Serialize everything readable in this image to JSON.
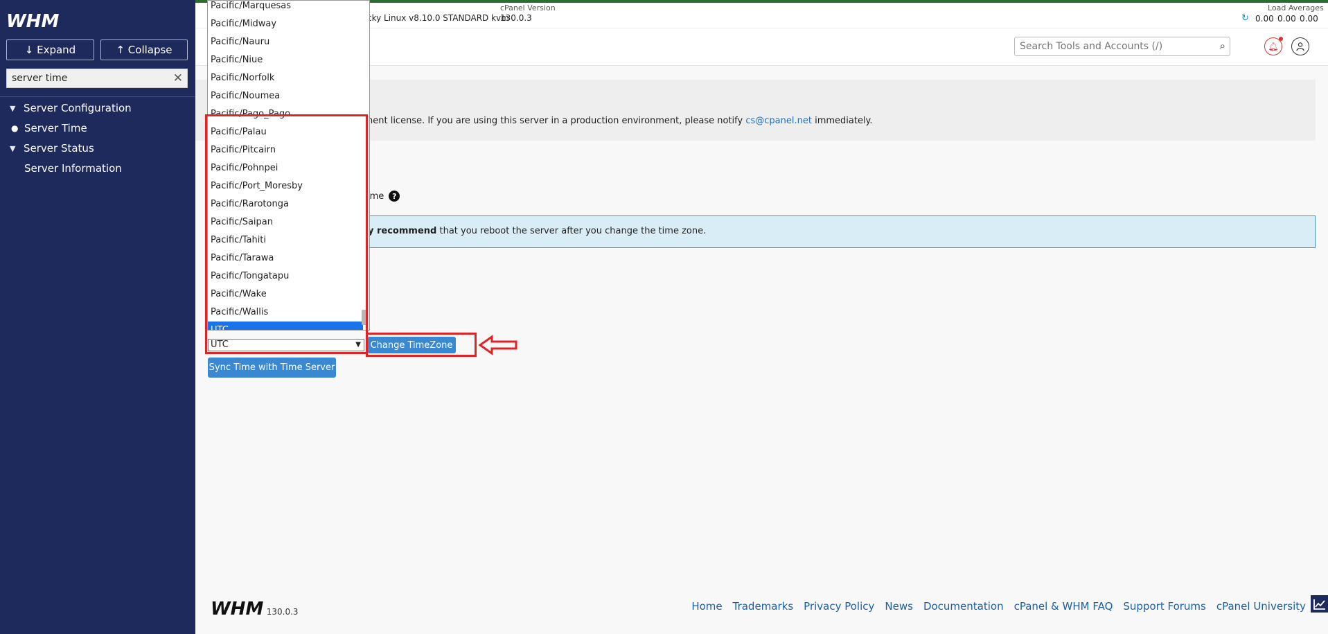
{
  "sidebar": {
    "logo_text": "WHM",
    "expand_label": "Expand",
    "collapse_label": "Collapse",
    "search_value": "server time",
    "nav": [
      {
        "label": "Server Configuration",
        "type": "group"
      },
      {
        "label": "Server Time",
        "type": "item"
      },
      {
        "label": "Server Status",
        "type": "group"
      },
      {
        "label": "Server Information",
        "type": "item"
      }
    ]
  },
  "header": {
    "os_text": "cky Linux v8.10.0 STANDARD kvm",
    "cpanel_version_label": "cPanel Version",
    "cpanel_version": "130.0.3",
    "load_label": "Load Averages",
    "load_values": [
      "0.00",
      "0.00",
      "0.00"
    ],
    "search_placeholder": "Search Tools and Accounts (/)"
  },
  "content": {
    "license_prefix": "nent license. If you are using this server in a production environment, please notify ",
    "license_email": "cs@cpanel.net",
    "license_suffix": " immediately.",
    "tz_heading": "ime",
    "info_bold": "y recommend",
    "info_rest": " that you reboot the server after you change the time zone."
  },
  "timezone_dropdown": {
    "options": [
      "Pacific/Marquesas",
      "Pacific/Midway",
      "Pacific/Nauru",
      "Pacific/Niue",
      "Pacific/Norfolk",
      "Pacific/Noumea",
      "Pacific/Pago_Pago",
      "Pacific/Palau",
      "Pacific/Pitcairn",
      "Pacific/Pohnpei",
      "Pacific/Port_Moresby",
      "Pacific/Rarotonga",
      "Pacific/Saipan",
      "Pacific/Tahiti",
      "Pacific/Tarawa",
      "Pacific/Tongatapu",
      "Pacific/Wake",
      "Pacific/Wallis",
      "UTC"
    ],
    "selected": "UTC"
  },
  "buttons": {
    "change_timezone": "Change TimeZone",
    "sync_time": "Sync Time with Time Server"
  },
  "footer": {
    "logo_text": "WHM",
    "version": "130.0.3",
    "links": [
      "Home",
      "Trademarks",
      "Privacy Policy",
      "News",
      "Documentation",
      "cPanel & WHM FAQ",
      "Support Forums",
      "cPanel University"
    ]
  },
  "colors": {
    "sidebar_bg": "#1f2a5c",
    "button_blue": "#3a87d2",
    "highlight_red": "#e02424",
    "selected_option": "#1a73e8",
    "info_bg": "#d9edf7"
  }
}
